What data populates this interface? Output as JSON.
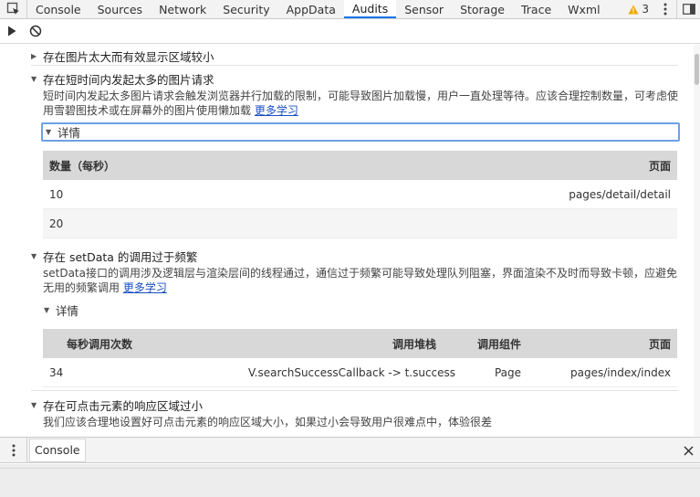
{
  "tabs": [
    {
      "label": "Console"
    },
    {
      "label": "Sources"
    },
    {
      "label": "Network"
    },
    {
      "label": "Security"
    },
    {
      "label": "AppData"
    },
    {
      "label": "Audits",
      "active": true
    },
    {
      "label": "Sensor"
    },
    {
      "label": "Storage"
    },
    {
      "label": "Trace"
    },
    {
      "label": "Wxml"
    }
  ],
  "warnings": {
    "count": "3",
    "icon": "warning-triangle-icon"
  },
  "audits": {
    "item1": {
      "title": "存在图片太大而有效显示区域较小"
    },
    "item2": {
      "title": "存在短时间内发起太多的图片请求",
      "desc_line1": "短时间内发起太多图片请求会触发浏览器并行加载的限制，可能导致图片加载慢，用户一直处理等待。应该合理控制数量，可考虑使",
      "desc_line2": "用雪碧图技术或在屏幕外的图片使用懒加载",
      "link": "更多学习",
      "details_label": "详情",
      "columns": [
        "数量（每秒）",
        "页面"
      ],
      "rows": [
        [
          "10",
          "pages/detail/detail"
        ],
        [
          "20",
          ""
        ]
      ]
    },
    "item3": {
      "title": "存在 setData 的调用过于频繁",
      "desc_line1": "setData接口的调用涉及逻辑层与渲染层间的线程通过，通信过于频繁可能导致处理队列阻塞，界面渲染不及时而导致卡顿，应避免",
      "desc_line2": "无用的频繁调用",
      "link": "更多学习",
      "details_label": "详情",
      "columns": [
        "每秒调用次数",
        "调用堆栈",
        "调用组件",
        "页面"
      ],
      "rows": [
        [
          "34",
          "V.searchSuccessCallback -> t.success",
          "Page",
          "pages/index/index"
        ]
      ]
    },
    "item4": {
      "title": "存在可点击元素的响应区域过小",
      "desc_line1": "我们应该合理地设置好可点击元素的响应区域大小，如果过小会导致用户很难点中，体验很差"
    }
  },
  "drawer": {
    "tab_label": "Console"
  },
  "colors": {
    "active_tab_underline": "#1a73e8",
    "link": "#1a4fc2",
    "warning": "#f2a600",
    "focus_outline": "#6fa0e8"
  }
}
